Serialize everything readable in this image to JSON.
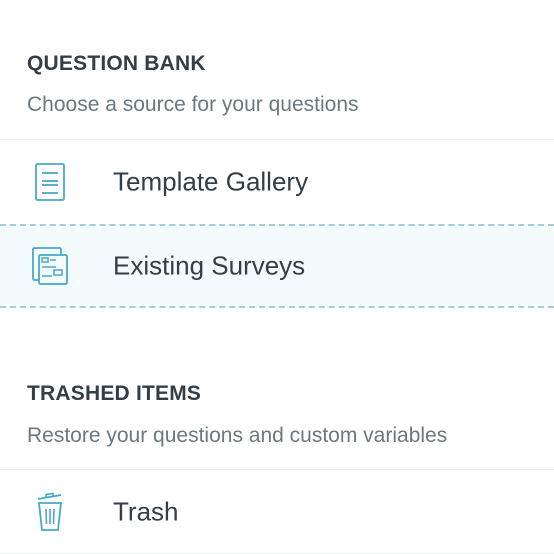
{
  "question_bank": {
    "title": "QUESTION BANK",
    "subtitle": "Choose a source for your questions",
    "items": [
      {
        "label": "Template Gallery",
        "icon": "template-gallery-icon"
      },
      {
        "label": "Existing Surveys",
        "icon": "existing-surveys-icon",
        "selected": true
      }
    ]
  },
  "trashed_items": {
    "title": "TRASHED ITEMS",
    "subtitle": "Restore your questions and custom variables",
    "items": [
      {
        "label": "Trash",
        "icon": "trash-icon"
      }
    ]
  },
  "colors": {
    "icon": "#4aa8c7",
    "selected_bg": "#f3fbfc",
    "selected_border": "#9fcfdc",
    "text": "#333e48",
    "subtext": "#6b787f",
    "divider": "#eceff0"
  }
}
